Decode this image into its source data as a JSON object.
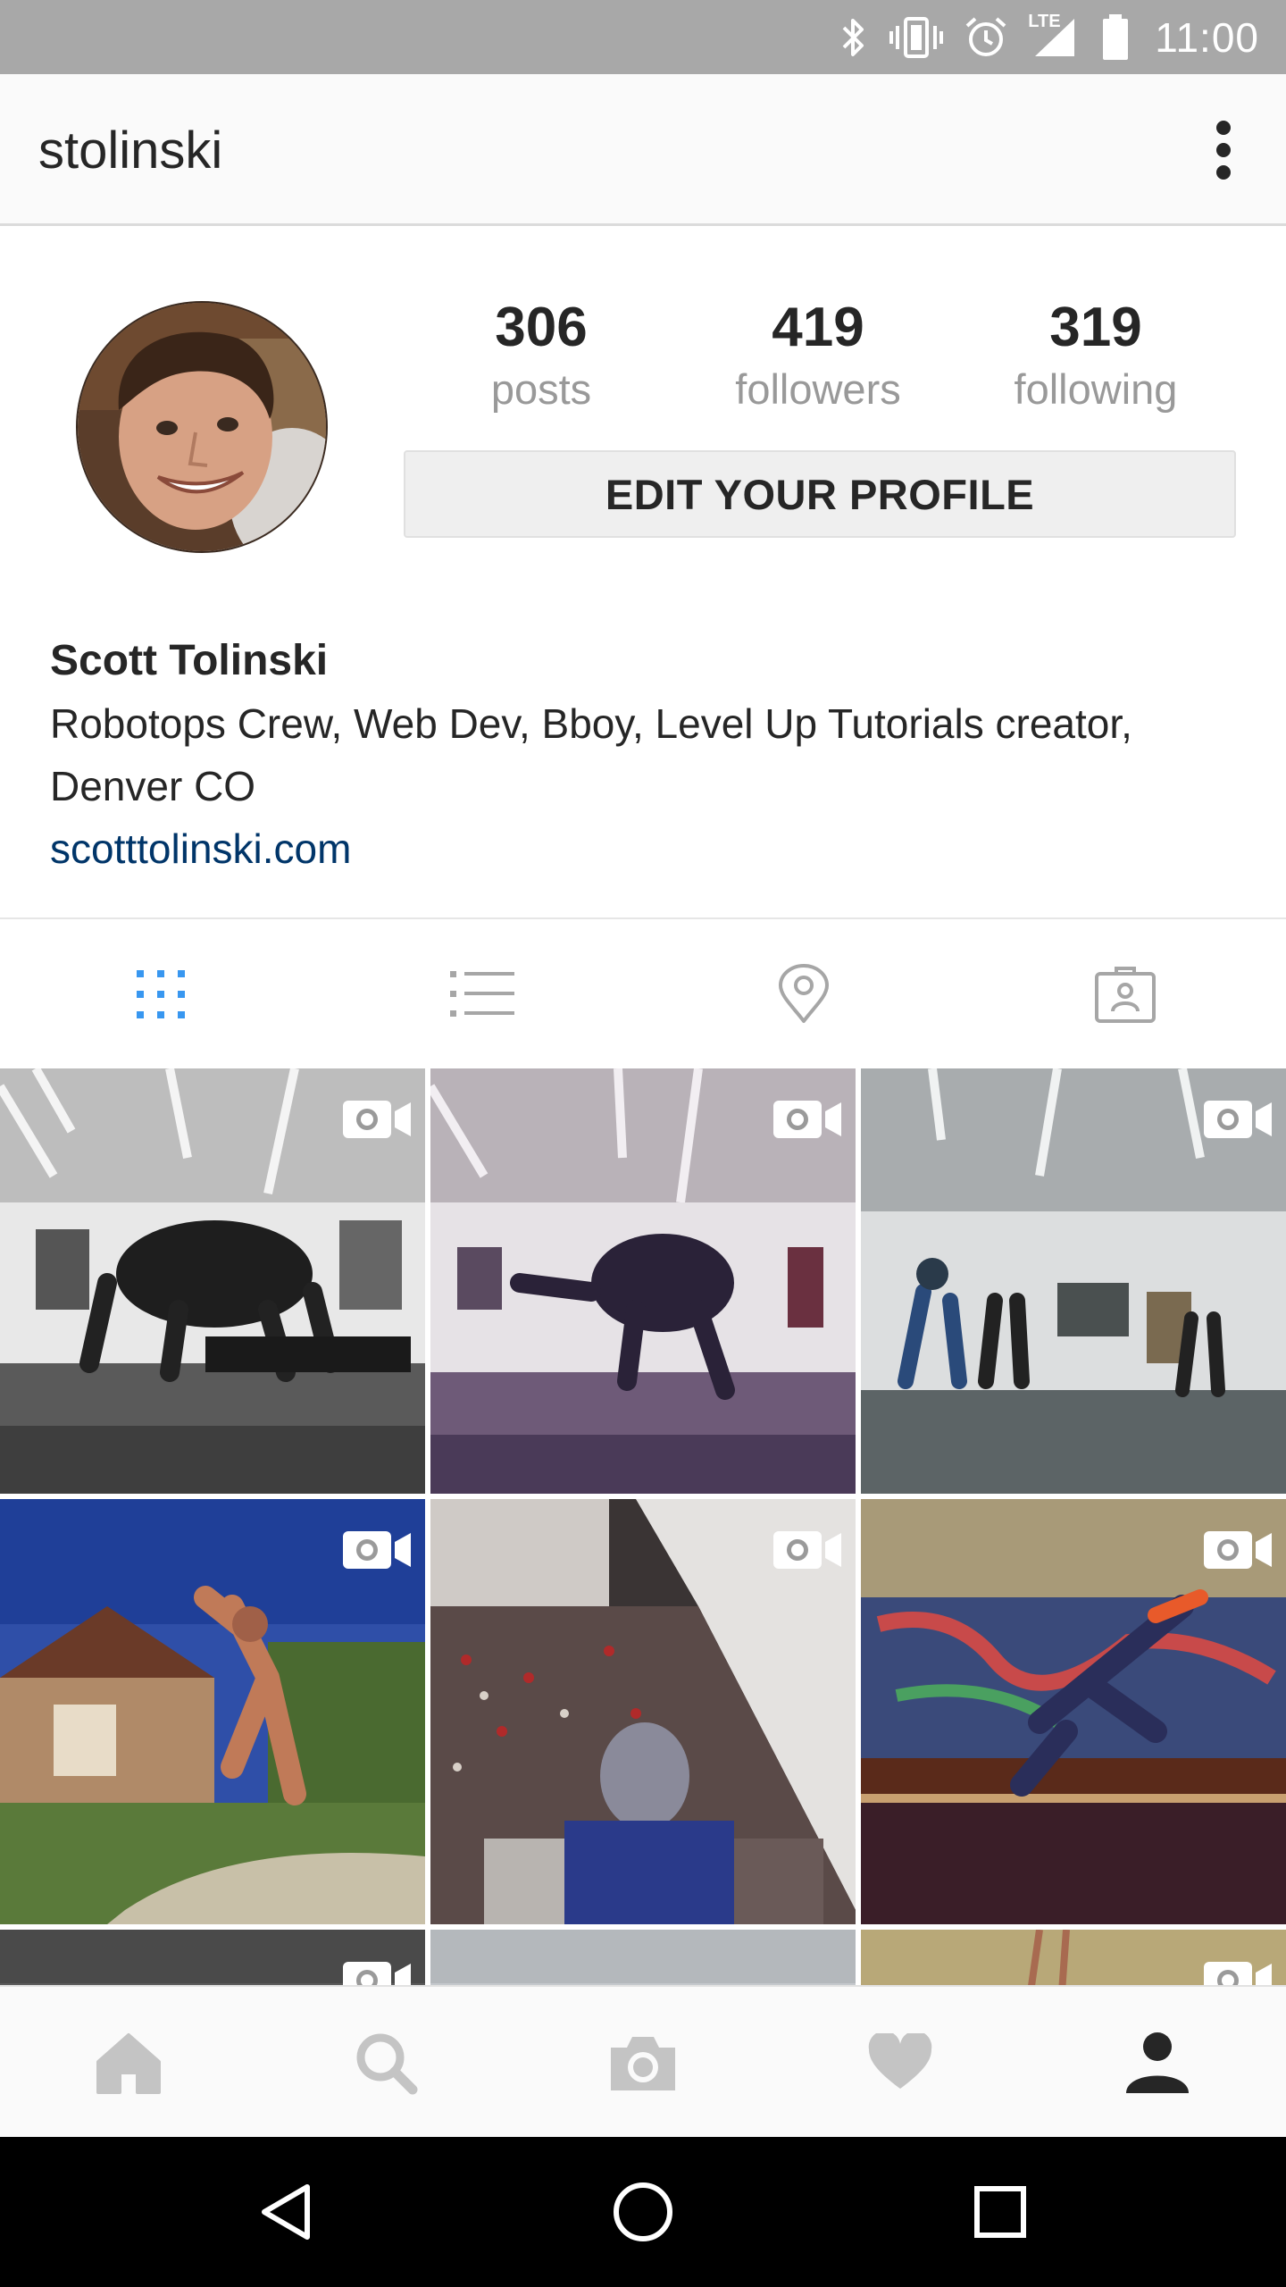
{
  "status_bar": {
    "time": "11:00",
    "network_label": "LTE",
    "icons": [
      "bluetooth-icon",
      "vibrate-icon",
      "alarm-icon",
      "signal-icon",
      "battery-icon"
    ]
  },
  "app_bar": {
    "username": "stolinski",
    "menu_icon": "overflow-menu-icon"
  },
  "profile": {
    "stats": [
      {
        "value": "306",
        "label": "posts"
      },
      {
        "value": "419",
        "label": "followers"
      },
      {
        "value": "319",
        "label": "following"
      }
    ],
    "edit_button_label": "EDIT YOUR PROFILE",
    "full_name": "Scott Tolinski",
    "bio": "Robotops Crew, Web Dev, Bboy, Level Up Tutorials creator, Denver CO",
    "website": "scotttolinski.com"
  },
  "tabs": [
    {
      "icon": "grid-icon",
      "active": true
    },
    {
      "icon": "list-icon",
      "active": false
    },
    {
      "icon": "location-pin-icon",
      "active": false
    },
    {
      "icon": "tagged-photos-icon",
      "active": false
    }
  ],
  "posts": [
    {
      "type": "video"
    },
    {
      "type": "video"
    },
    {
      "type": "video"
    },
    {
      "type": "video"
    },
    {
      "type": "video"
    },
    {
      "type": "video"
    },
    {
      "type": "video"
    },
    {
      "type": "photo"
    },
    {
      "type": "video"
    }
  ],
  "bottom_nav": [
    {
      "icon": "home-icon",
      "active": false
    },
    {
      "icon": "search-icon",
      "active": false
    },
    {
      "icon": "camera-icon",
      "active": false
    },
    {
      "icon": "heart-icon",
      "active": false
    },
    {
      "icon": "profile-icon",
      "active": true
    }
  ],
  "system_nav": [
    "back-icon",
    "home-circle-icon",
    "recents-icon"
  ],
  "colors": {
    "accent": "#3897f0",
    "link": "#003569",
    "muted": "#999999",
    "status_bar": "#a8a8a8"
  }
}
